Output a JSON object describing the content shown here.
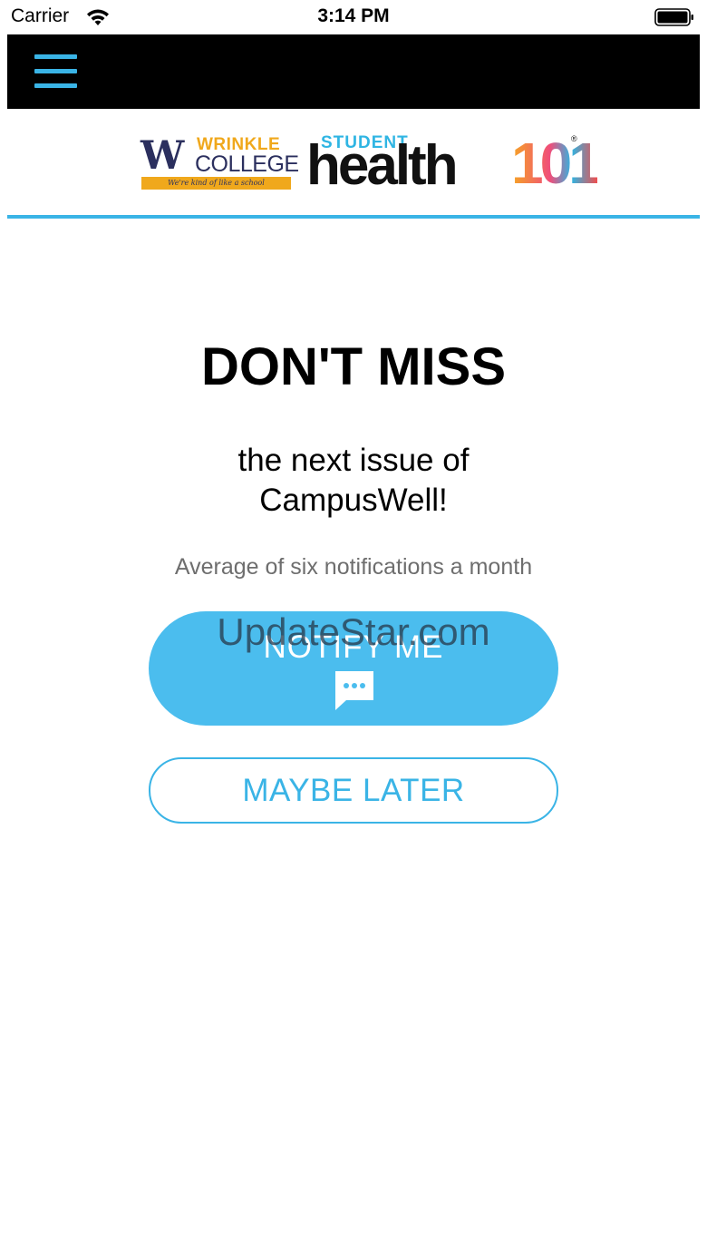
{
  "status_bar": {
    "carrier": "Carrier",
    "time": "3:14 PM",
    "wifi_icon": "wifi-icon",
    "battery_icon": "battery-icon"
  },
  "nav": {
    "menu_icon": "hamburger-menu-icon",
    "accent_color": "#3ab4e6",
    "background": "#000000"
  },
  "logos": {
    "college": {
      "mark": "W",
      "name_line1": "WRINKLE",
      "name_line2": "COLLEGE",
      "tagline": "We're kind of like a school"
    },
    "partner": {
      "prefix": "STUDENT",
      "name": "health",
      "number": "101",
      "registered": "®"
    }
  },
  "main": {
    "headline": "DON'T MISS",
    "subhead": "the next issue of CampusWell!",
    "note": "Average of six notifications a month",
    "notify_button": {
      "label": "NOTIFY ME",
      "icon": "chat-bubble-icon",
      "color": "#4bbdee"
    },
    "later_button": {
      "label": "MAYBE LATER",
      "color": "#3ab4e6"
    },
    "watermark": "UpdateStar.com"
  }
}
